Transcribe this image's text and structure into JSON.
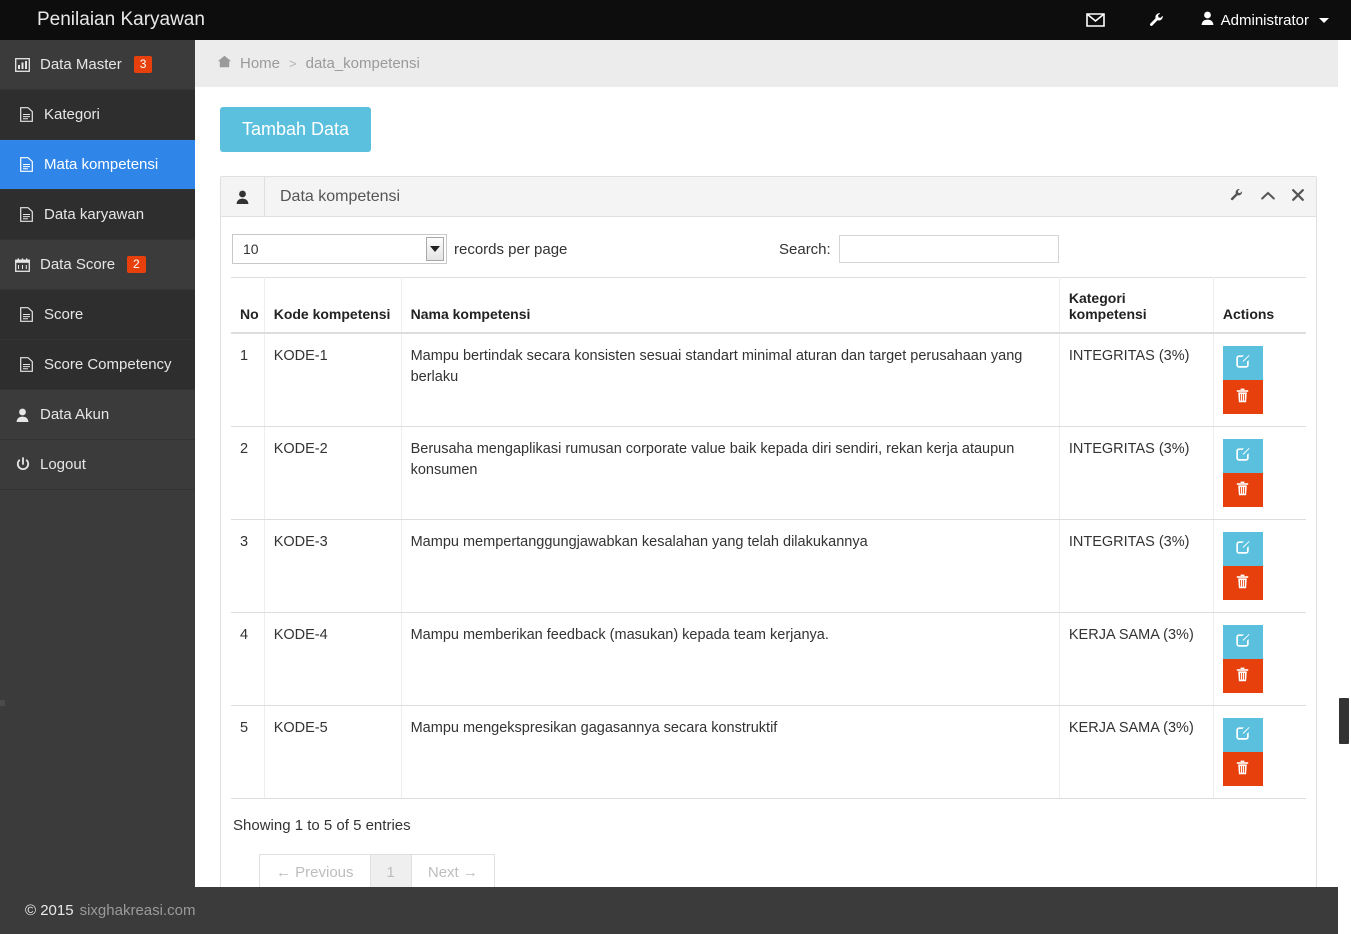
{
  "navbar": {
    "brand": "Penilaian Karyawan",
    "mail_icon": "envelope-icon",
    "wrench_icon": "wrench-icon",
    "user_icon": "user-icon",
    "user_label": "Administrator"
  },
  "sidebar": {
    "items": [
      {
        "label": "Data Master",
        "icon": "bar-chart-icon",
        "badge": "3",
        "type": "header",
        "active": false
      },
      {
        "label": "Kategori",
        "icon": "file-icon",
        "badge": "",
        "type": "sub",
        "active": false
      },
      {
        "label": "Mata kompetensi",
        "icon": "file-icon",
        "badge": "",
        "type": "sub",
        "active": true
      },
      {
        "label": "Data karyawan",
        "icon": "file-icon",
        "badge": "",
        "type": "sub",
        "active": false
      },
      {
        "label": "Data Score",
        "icon": "calendar-icon",
        "badge": "2",
        "type": "header",
        "active": false
      },
      {
        "label": "Score",
        "icon": "file-icon",
        "badge": "",
        "type": "sub",
        "active": false
      },
      {
        "label": "Score Competency",
        "icon": "file-icon",
        "badge": "",
        "type": "sub",
        "active": false
      },
      {
        "label": "Data Akun",
        "icon": "user-icon",
        "badge": "",
        "type": "header",
        "active": false
      },
      {
        "label": "Logout",
        "icon": "power-icon",
        "badge": "",
        "type": "header",
        "active": false
      }
    ]
  },
  "breadcrumb": {
    "home_icon": "home-icon",
    "home": "Home",
    "separator": ">",
    "current": "data_kompetensi"
  },
  "toolbar": {
    "add_label": "Tambah Data"
  },
  "panel": {
    "header_icon": "user-icon",
    "title": "Data kompetensi",
    "tool_config": "wrench-icon",
    "tool_collapse": "chevron-up-icon",
    "tool_close": "times-icon"
  },
  "datatable": {
    "length_value": "10",
    "length_label": "records per page",
    "search_label": "Search:",
    "search_value": "",
    "search_placeholder": "",
    "columns": [
      "No",
      "Kode kompetensi",
      "Nama kompetensi",
      "Kategori kompetensi",
      "Actions"
    ],
    "rows": [
      {
        "no": "1",
        "kode": "KODE-1",
        "nama": "Mampu bertindak secara konsisten sesuai standart minimal aturan dan target perusahaan yang berlaku",
        "kategori": "INTEGRITAS (3%)",
        "edit_icon": "pencil-square-icon",
        "delete_icon": "trash-icon"
      },
      {
        "no": "2",
        "kode": "KODE-2",
        "nama": "Berusaha mengaplikasi rumusan corporate value baik kepada diri sendiri, rekan kerja ataupun konsumen",
        "kategori": "INTEGRITAS (3%)",
        "edit_icon": "pencil-square-icon",
        "delete_icon": "trash-icon"
      },
      {
        "no": "3",
        "kode": "KODE-3",
        "nama": "Mampu mempertanggungjawabkan kesalahan yang telah dilakukannya",
        "kategori": "INTEGRITAS (3%)",
        "edit_icon": "pencil-square-icon",
        "delete_icon": "trash-icon"
      },
      {
        "no": "4",
        "kode": "KODE-4",
        "nama": "Mampu memberikan feedback (masukan) kepada team kerjanya.",
        "kategori": "KERJA SAMA (3%)",
        "edit_icon": "pencil-square-icon",
        "delete_icon": "trash-icon"
      },
      {
        "no": "5",
        "kode": "KODE-5",
        "nama": "Mampu mengekspresikan gagasannya secara konstruktif",
        "kategori": "KERJA SAMA (3%)",
        "edit_icon": "pencil-square-icon",
        "delete_icon": "trash-icon"
      }
    ],
    "info": "Showing 1 to 5 of 5 entries",
    "pager": {
      "previous": "← Previous",
      "page_1": "1",
      "next": "Next →"
    }
  },
  "footer": {
    "copyright": "© 2015",
    "link": "sixghakreasi.com"
  },
  "colors": {
    "navbar_bg": "#0d0d0d",
    "sidebar_bg": "#3b3b3b",
    "sidebar_sub_bg": "#2e2e2e",
    "active_blue": "#2f86e8",
    "info_blue": "#5bc0de",
    "danger_orange": "#e8400c",
    "breadcrumb_bg": "#ececec"
  }
}
